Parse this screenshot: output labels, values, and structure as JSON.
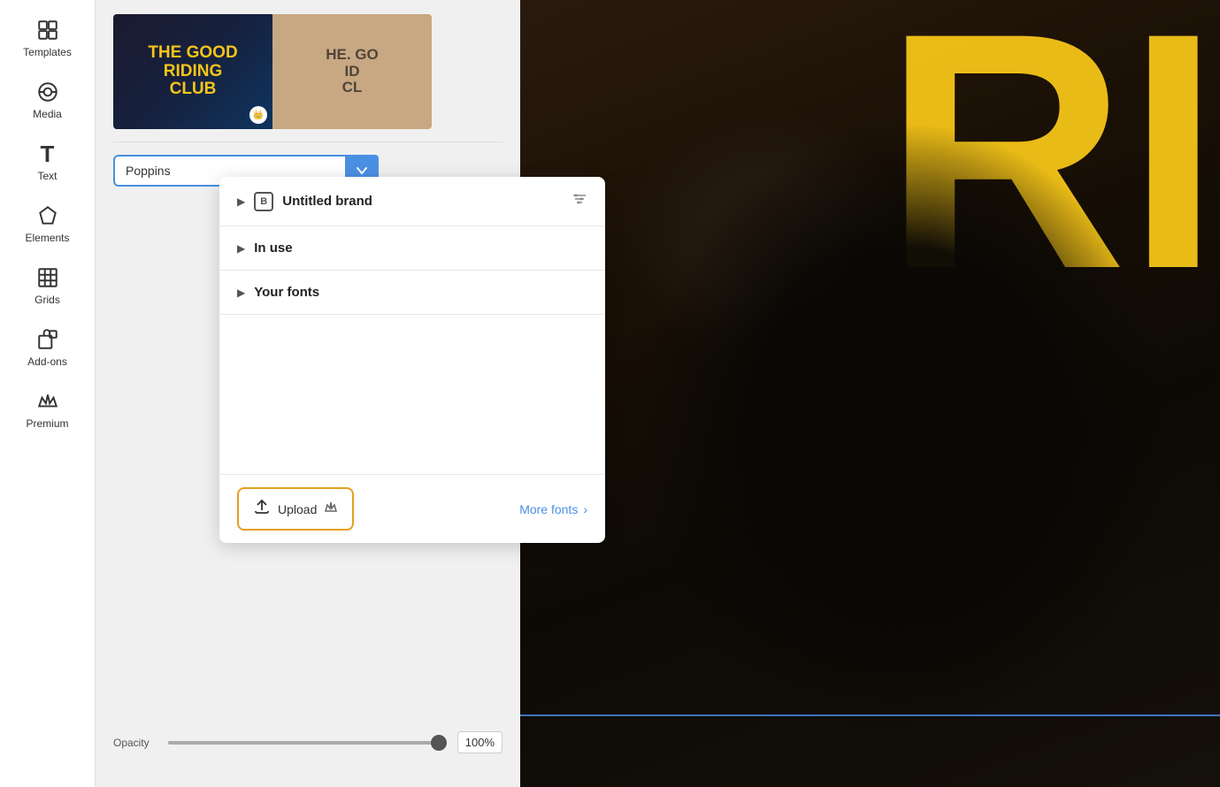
{
  "sidebar": {
    "items": [
      {
        "id": "templates",
        "label": "Templates",
        "icon": "⧉"
      },
      {
        "id": "media",
        "label": "Media",
        "icon": "◫"
      },
      {
        "id": "text",
        "label": "Text",
        "icon": "T"
      },
      {
        "id": "elements",
        "label": "Elements",
        "icon": "✦"
      },
      {
        "id": "grids",
        "label": "Grids",
        "icon": "⊞"
      },
      {
        "id": "addons",
        "label": "Add-ons",
        "icon": "🛍"
      },
      {
        "id": "premium",
        "label": "Premium",
        "icon": "👑"
      }
    ]
  },
  "thumbnail1": {
    "title": "THE GOOD RIDING CLUB"
  },
  "fontSelector": {
    "value": "Poppins",
    "placeholder": "Poppins"
  },
  "dropdown": {
    "sections": [
      {
        "id": "untitled-brand",
        "label": "Untitled brand",
        "hasFilterIcon": true
      },
      {
        "id": "in-use",
        "label": "In use",
        "hasFilterIcon": false
      },
      {
        "id": "your-fonts",
        "label": "Your fonts",
        "hasFilterIcon": false
      }
    ],
    "footer": {
      "uploadLabel": "Upload",
      "moreFontsLabel": "More fonts"
    }
  },
  "opacity": {
    "label": "Opacity",
    "value": "100%",
    "sliderValue": 100
  },
  "canvas": {
    "letters": "RI"
  }
}
